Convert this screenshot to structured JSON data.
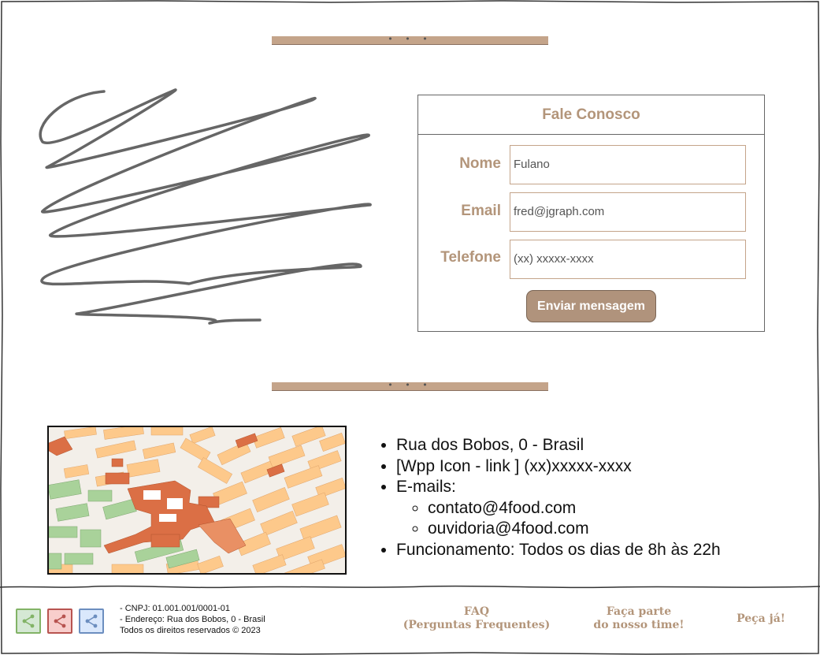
{
  "contact_form": {
    "title": "Fale Conosco",
    "fields": [
      {
        "label": "Nome",
        "value": "Fulano"
      },
      {
        "label": "Email",
        "value": "fred@jgraph.com"
      },
      {
        "label": "Telefone",
        "value": "(xx) xxxxx-xxxx"
      }
    ],
    "submit_label": "Enviar mensagem"
  },
  "divider_dots": "• • •",
  "info": {
    "address": "Rua dos Bobos, 0 - Brasil",
    "whatsapp": "[Wpp Icon - link ] (xx)xxxxx-xxxx",
    "emails_label": "E-mails:",
    "emails": [
      "contato@4food.com",
      "ouvidoria@4food.com"
    ],
    "hours": "Funcionamento: Todos os dias de 8h às 22h"
  },
  "footer": {
    "share_icons": [
      {
        "name": "share-icon",
        "color": "#82b366",
        "bg": "#d5e8d4"
      },
      {
        "name": "share-icon",
        "color": "#b85450",
        "bg": "#f8cecc"
      },
      {
        "name": "share-icon",
        "color": "#6c8ebf",
        "bg": "#dae8fc"
      }
    ],
    "legal": [
      "- CNPJ: 01.001.001/0001-01",
      "- Endereço: Rua dos Bobos, 0 - Brasil",
      "Todos os direitos reservados © 2023"
    ],
    "faq_line1": "FAQ",
    "faq_line2": "(Perguntas Frequentes)",
    "join_line1": "Faça parte",
    "join_line2": "do nosso time!",
    "order": "Peça já!"
  },
  "colors": {
    "accent": "#b3957a",
    "button": "#b0937c",
    "divider": "#c4a48a"
  }
}
